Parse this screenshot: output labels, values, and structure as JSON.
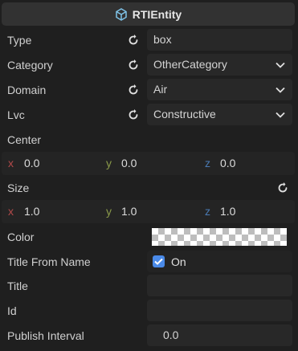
{
  "header": {
    "title": "RTIEntity",
    "icon": "cube-icon"
  },
  "fields": {
    "type": {
      "label": "Type",
      "value": "box"
    },
    "category": {
      "label": "Category",
      "value": "OtherCategory"
    },
    "domain": {
      "label": "Domain",
      "value": "Air"
    },
    "lvc": {
      "label": "Lvc",
      "value": "Constructive"
    },
    "center": {
      "label": "Center",
      "x": "0.0",
      "y": "0.0",
      "z": "0.0"
    },
    "size": {
      "label": "Size",
      "x": "1.0",
      "y": "1.0",
      "z": "1.0"
    },
    "color": {
      "label": "Color"
    },
    "title_from_name": {
      "label": "Title From Name",
      "checked": true,
      "value_label": "On"
    },
    "title": {
      "label": "Title",
      "value": ""
    },
    "id": {
      "label": "Id",
      "value": ""
    },
    "publish_interval": {
      "label": "Publish Interval",
      "value": "0.0"
    }
  },
  "axes": {
    "x": "x",
    "y": "y",
    "z": "z"
  },
  "colors": {
    "checkbox": "#4a8ae8",
    "axis_x": "#b34a4a",
    "axis_y": "#8a9a4a",
    "axis_z": "#4a7ab3"
  }
}
